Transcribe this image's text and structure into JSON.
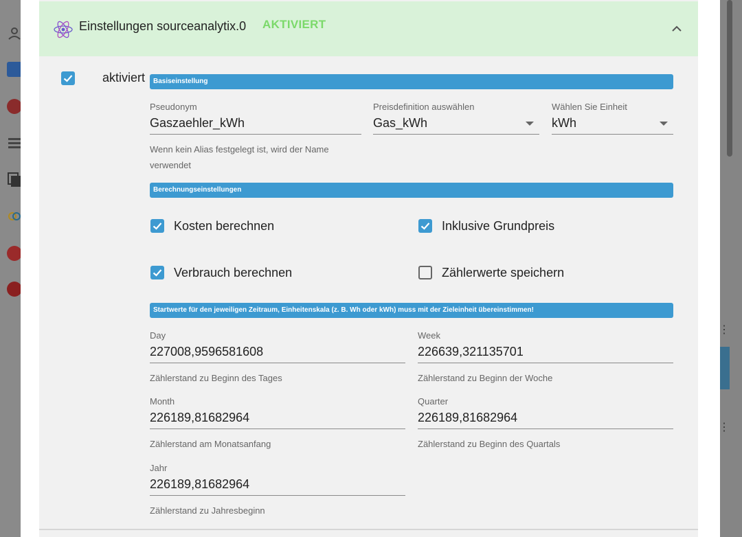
{
  "background": {
    "sidebar_icons": [
      "person-icon",
      "js-icon",
      "adapter-icon",
      "list-icon",
      "files-icon",
      "rings-icon",
      "clock-icon",
      "z-icon"
    ]
  },
  "panel": {
    "title": "Einstellungen sourceanalytix.0",
    "status": "AKTIVIERT",
    "enabled_label": "aktiviert",
    "enabled": true
  },
  "sections": {
    "basic": "Basiseinstellung",
    "calc": "Berechnungseinstellungen",
    "start": "Startwerte für den jeweiligen Zeitraum, Einheitenskala (z. B. Wh oder kWh) muss mit der Zieleinheit übereinstimmen!"
  },
  "basic": {
    "alias": {
      "label": "Pseudonym",
      "value": "Gaszaehler_kWh",
      "help": "Wenn kein Alias festgelegt ist, wird der Name verwendet"
    },
    "price": {
      "label": "Preisdefinition auswählen",
      "value": "Gas_kWh"
    },
    "unit": {
      "label": "Wählen Sie Einheit",
      "value": "kWh"
    }
  },
  "calc": {
    "costs": {
      "label": "Kosten berechnen",
      "checked": true
    },
    "base_price": {
      "label": "Inklusive Grundpreis",
      "checked": true
    },
    "consumption": {
      "label": "Verbrauch berechnen",
      "checked": true
    },
    "meter_values": {
      "label": "Zählerwerte speichern",
      "checked": false
    }
  },
  "start": {
    "day": {
      "label": "Day",
      "value": "227008,9596581608",
      "help": "Zählerstand zu Beginn des Tages"
    },
    "week": {
      "label": "Week",
      "value": "226639,321135701",
      "help": "Zählerstand zu Beginn der Woche"
    },
    "month": {
      "label": "Month",
      "value": "226189,81682964",
      "help": "Zählerstand am Monatsanfang"
    },
    "quarter": {
      "label": "Quarter",
      "value": "226189,81682964",
      "help": "Zählerstand zu Beginn des Quartals"
    },
    "year": {
      "label": "Jahr",
      "value": "226189,81682964",
      "help": "Zählerstand zu Jahresbeginn"
    }
  },
  "colors": {
    "accent": "#3d9ad1",
    "header_bg": "#d9f2d9",
    "status_green": "#7bd96a"
  }
}
